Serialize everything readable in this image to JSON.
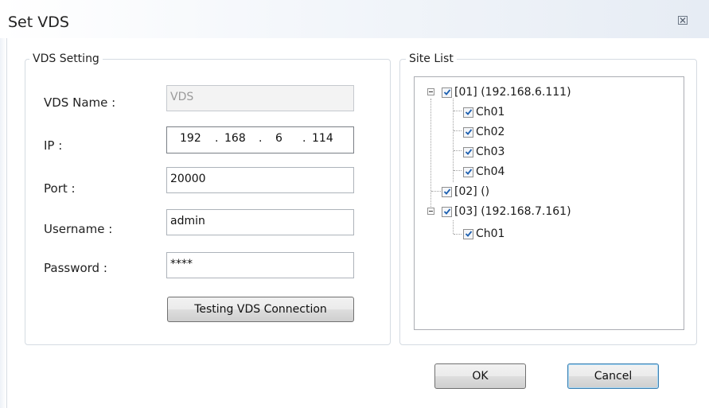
{
  "window": {
    "title": "Set VDS",
    "close_icon": "close-icon"
  },
  "vds_setting": {
    "caption": "VDS Setting",
    "name_label": "VDS Name :",
    "name_value": "VDS",
    "ip_label": "IP :",
    "ip_parts": [
      "192",
      "168",
      "6",
      "114"
    ],
    "port_label": "Port :",
    "port_value": "20000",
    "username_label": "Username :",
    "username_value": "admin",
    "password_label": "Password :",
    "password_value": "****",
    "test_button": "Testing VDS Connection"
  },
  "site_list": {
    "caption": "Site List",
    "nodes": [
      {
        "label": "[01]  (192.168.6.111)",
        "checked": true,
        "expanded": true,
        "children": [
          "Ch01",
          "Ch02",
          "Ch03",
          "Ch04"
        ]
      },
      {
        "label": "[02]  ()",
        "checked": true
      },
      {
        "label": "[03]  (192.168.7.161)",
        "checked": true,
        "expanded": true,
        "children": [
          "Ch01"
        ]
      }
    ]
  },
  "buttons": {
    "ok": "OK",
    "cancel": "Cancel"
  },
  "colors": {
    "check": "#1c5fb0",
    "focus_border": "#3c7fb1"
  }
}
